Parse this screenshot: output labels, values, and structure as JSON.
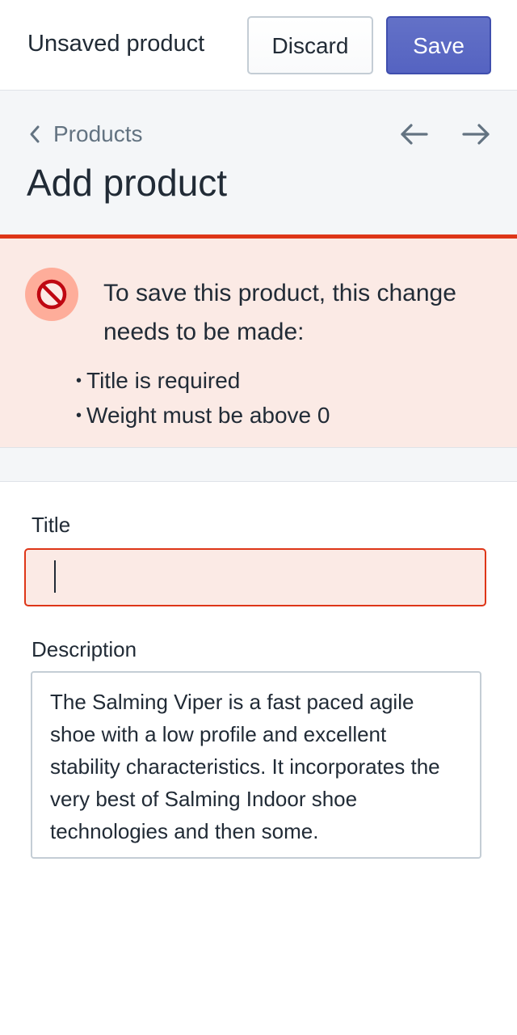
{
  "topbar": {
    "title": "Unsaved product",
    "discard_label": "Discard",
    "save_label": "Save"
  },
  "header": {
    "breadcrumb_label": "Products",
    "page_title": "Add product"
  },
  "error_banner": {
    "heading": "To save this product, this change needs to be made:",
    "errors": [
      "Title is required",
      "Weight must be above 0"
    ]
  },
  "form": {
    "title_label": "Title",
    "title_value": "",
    "description_label": "Description",
    "description_value": "The Salming Viper is a fast paced agile shoe with a low profile and excellent stability characteristics. It incorporates the very best of Salming Indoor shoe technologies and then some."
  },
  "colors": {
    "primary": "#5c6ac4",
    "critical": "#de3618",
    "critical_bg": "#fbeae5"
  },
  "icons": {
    "back": "chevron-left-icon",
    "prev": "arrow-left-icon",
    "next": "arrow-right-icon",
    "error": "prohibited-icon"
  }
}
